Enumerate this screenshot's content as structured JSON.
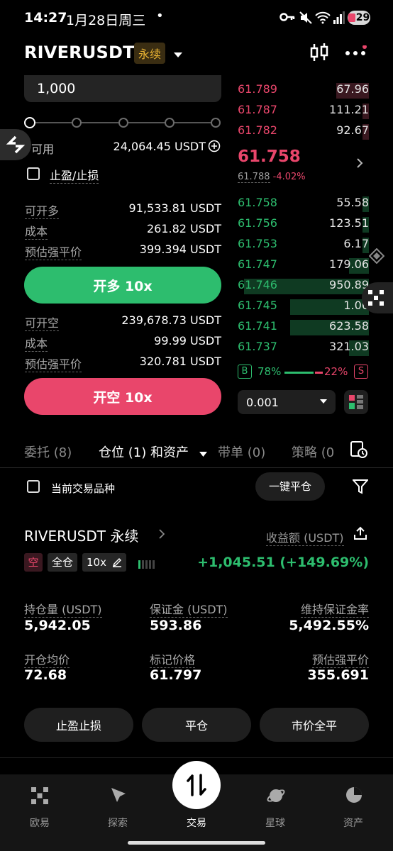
{
  "status_bar": {
    "time": "14:27",
    "date": "1月28日周三",
    "dot": "•",
    "battery": "29"
  },
  "header": {
    "symbol": "RIVERUSDT",
    "badge": "永续"
  },
  "order_form": {
    "amount_value": "1,000",
    "available_label": "可用",
    "available_value": "24,064.45 USDT",
    "tp_sl_label": "止盈/止损",
    "long": {
      "can_open_label": "可开多",
      "can_open_value": "91,533.81 USDT",
      "cost_label": "成本",
      "cost_value": "261.82 USDT",
      "liq_label": "预估强平价",
      "liq_value": "399.394 USDT",
      "button": "开多 10x"
    },
    "short": {
      "can_open_label": "可开空",
      "can_open_value": "239,678.73 USDT",
      "cost_label": "成本",
      "cost_value": "99.99 USDT",
      "liq_label": "预估强平价",
      "liq_value": "320.781 USDT",
      "button": "开空 10x"
    }
  },
  "order_book": {
    "asks": [
      {
        "price": "61.789",
        "qty": "67.96",
        "depth": 0.25
      },
      {
        "price": "61.787",
        "qty": "111.21",
        "depth": 0.05
      },
      {
        "price": "61.782",
        "qty": "92.67",
        "depth": 0.05
      }
    ],
    "last_price": "61.758",
    "mark_price": "61.788",
    "change": "-4.02%",
    "bids": [
      {
        "price": "61.758",
        "qty": "55.58",
        "depth": 0.05
      },
      {
        "price": "61.756",
        "qty": "123.51",
        "depth": 0.05
      },
      {
        "price": "61.753",
        "qty": "6.17",
        "depth": 0.05
      },
      {
        "price": "61.747",
        "qty": "179.06",
        "depth": 0.15
      },
      {
        "price": "61.746",
        "qty": "950.89",
        "depth": 0.95
      },
      {
        "price": "61.745",
        "qty": "1.06",
        "depth": 0.6
      },
      {
        "price": "61.741",
        "qty": "623.58",
        "depth": 0.6
      },
      {
        "price": "61.737",
        "qty": "321.03",
        "depth": 0.15
      }
    ],
    "buy_label": "B",
    "buy_pct": "78%",
    "sell_pct": "22%",
    "sell_label": "S",
    "buy_ratio": 0.78,
    "precision": "0.001"
  },
  "tabs": [
    "委托 (8)",
    "仓位 (1) 和资产",
    "带单 (0)",
    "策略 (0"
  ],
  "filter": {
    "current_symbol_label": "当前交易品种",
    "close_all_button": "一键平仓"
  },
  "position": {
    "symbol": "RIVERUSDT 永续",
    "pnl_label": "收益额 (USDT)",
    "side_tag": "空",
    "margin_tag": "全仓",
    "leverage_tag": "10x",
    "pnl_value": "+1,045.51 (+149.69%)",
    "size_label": "持仓量 (USDT)",
    "size_value": "5,942.05",
    "margin_label": "保证金 (USDT)",
    "margin_value": "593.86",
    "mmr_label": "维持保证金率",
    "mmr_value": "5,492.55%",
    "entry_label": "开仓均价",
    "entry_value": "72.68",
    "mark_label": "标记价格",
    "mark_value": "61.797",
    "liq_label": "预估强平价",
    "liq_value": "355.691",
    "btn_tpsl": "止盈止损",
    "btn_close": "平仓",
    "btn_market_close": "市价全平"
  },
  "bottom_nav": [
    "欧易",
    "探索",
    "交易",
    "星球",
    "资产"
  ],
  "colors": {
    "green": "#2dbd6e",
    "red": "#e9466b",
    "badge": "#e8b233"
  }
}
